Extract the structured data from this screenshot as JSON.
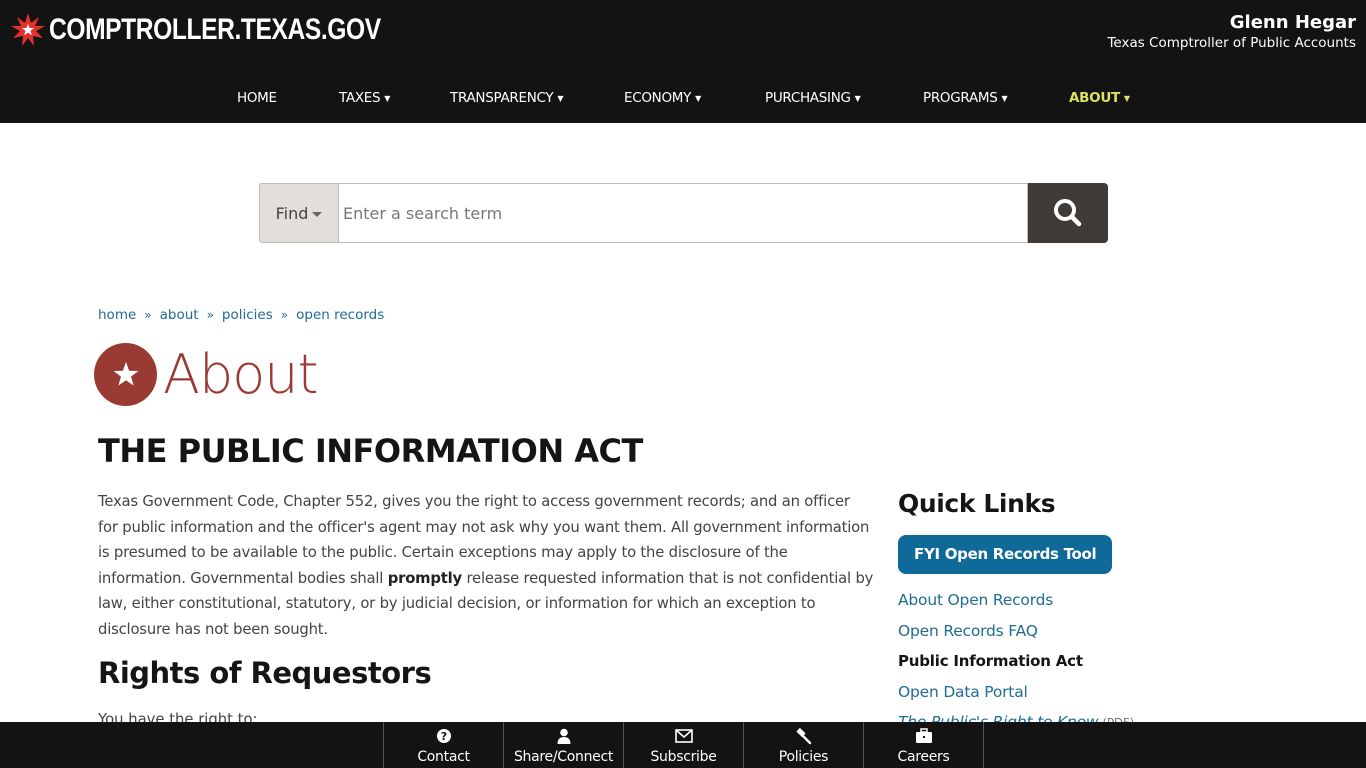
{
  "header": {
    "site_name": "COMPTROLLER.TEXAS.GOV",
    "officer_name": "Glenn Hegar",
    "officer_title": "Texas Comptroller of Public Accounts"
  },
  "nav": {
    "items": [
      {
        "label": "HOME",
        "has_dropdown": false
      },
      {
        "label": "TAXES",
        "has_dropdown": true
      },
      {
        "label": "TRANSPARENCY",
        "has_dropdown": true
      },
      {
        "label": "ECONOMY",
        "has_dropdown": true
      },
      {
        "label": "PURCHASING",
        "has_dropdown": true
      },
      {
        "label": "PROGRAMS",
        "has_dropdown": true
      },
      {
        "label": "ABOUT",
        "has_dropdown": true,
        "active": true
      }
    ],
    "caret": "▼",
    "active_color": "#dbe260"
  },
  "search": {
    "find_label": "Find",
    "placeholder": "Enter a search term",
    "value": "",
    "button_icon": "search-icon"
  },
  "breadcrumb": {
    "items": [
      "home",
      "about",
      "policies",
      "open records"
    ],
    "separator": "»"
  },
  "section": {
    "title": "About",
    "icon": "star-icon",
    "color": "#9a3b33"
  },
  "main": {
    "title": "THE PUBLIC INFORMATION ACT",
    "intro_before_bold": "Texas Government Code, Chapter 552, gives you the right to access government records; and an officer for public information and the officer's agent may not ask why you want them. All government information is presumed to be available to the public. Certain exceptions may apply to the disclosure of the information. Governmental bodies shall ",
    "intro_bold": "promptly",
    "intro_after_bold": " release requested information that is not confidential by law, either constitutional, statutory, or by judicial decision, or information for which an exception to disclosure has not been sought.",
    "subheading": "Rights of Requestors",
    "sub_paragraph": "You have the right to:"
  },
  "quick_links": {
    "title": "Quick Links",
    "button_label": "FYI Open Records Tool",
    "button_color": "#0f6a9a",
    "items": [
      {
        "label": "About Open Records"
      },
      {
        "label": "Open Records FAQ"
      },
      {
        "label": "Public Information Act",
        "current": true
      },
      {
        "label": "Open Data Portal"
      },
      {
        "label": "The Public's Right to Know",
        "suffix": "(PDF)"
      }
    ]
  },
  "footer": {
    "items": [
      {
        "label": "Contact",
        "icon": "question-circle-icon"
      },
      {
        "label": "Share/Connect",
        "icon": "user-icon"
      },
      {
        "label": "Subscribe",
        "icon": "envelope-icon"
      },
      {
        "label": "Policies",
        "icon": "gavel-icon"
      },
      {
        "label": "Careers",
        "icon": "briefcase-icon"
      }
    ]
  }
}
